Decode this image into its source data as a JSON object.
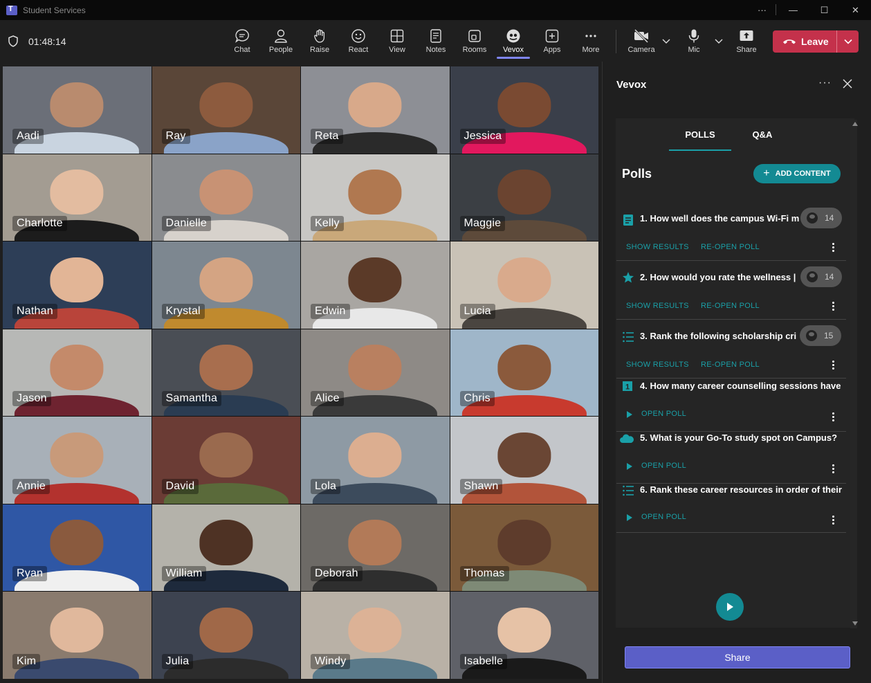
{
  "window": {
    "title": "Student Services",
    "controls": [
      "···",
      "—",
      "☐",
      "✕"
    ]
  },
  "meeting": {
    "timer": "01:48:14",
    "tools": [
      {
        "label": "Chat",
        "icon": "chat-icon"
      },
      {
        "label": "People",
        "icon": "people-icon"
      },
      {
        "label": "Raise",
        "icon": "raise-hand-icon"
      },
      {
        "label": "React",
        "icon": "react-smiley-icon"
      },
      {
        "label": "View",
        "icon": "view-grid-icon"
      },
      {
        "label": "Notes",
        "icon": "notes-icon"
      },
      {
        "label": "Rooms",
        "icon": "rooms-icon"
      },
      {
        "label": "Vevox",
        "icon": "vevox-icon",
        "active": true
      },
      {
        "label": "Apps",
        "icon": "apps-plus-icon"
      },
      {
        "label": "More",
        "icon": "more-dots-icon"
      }
    ],
    "camera_label": "Camera",
    "mic_label": "Mic",
    "share_label": "Share",
    "leave_label": "Leave",
    "leave_color": "#c4314b",
    "accent_color": "#7f85f5"
  },
  "participants": [
    "Aadi",
    "Ray",
    "Reta",
    "Jessica",
    "Charlotte",
    "Danielle",
    "Kelly",
    "Maggie",
    "Nathan",
    "Krystal",
    "Edwin",
    "Lucia",
    "Jason",
    "Samantha",
    "Alice",
    "Chris",
    "Annie",
    "David",
    "Lola",
    "Shawn",
    "Ryan",
    "William",
    "Deborah",
    "Thomas",
    "Kim",
    "Julia",
    "Windy",
    "Isabelle"
  ],
  "panel": {
    "title": "Vevox",
    "more": "···",
    "tabs": [
      "POLLS",
      "Q&A"
    ],
    "active_tab": "POLLS",
    "heading": "Polls",
    "add_content_label": "ADD CONTENT",
    "brand_color": "#138a93",
    "polls": [
      {
        "question": "1. How well does the campus Wi-Fi m",
        "icon": "text-poll-icon",
        "responses": "14",
        "actions": [
          "SHOW RESULTS",
          "RE-OPEN POLL"
        ]
      },
      {
        "question": "2. How would you rate the wellness |",
        "icon": "star-rating-icon",
        "responses": "14",
        "actions": [
          "SHOW RESULTS",
          "RE-OPEN POLL"
        ]
      },
      {
        "question": "3. Rank the following scholarship cri",
        "icon": "ranking-list-icon",
        "responses": "15",
        "actions": [
          "SHOW RESULTS",
          "RE-OPEN POLL"
        ]
      },
      {
        "question": "4. How many career counselling sessions have",
        "icon": "numeric-poll-icon",
        "actions": [
          "OPEN POLL"
        ]
      },
      {
        "question": "5. What is your Go-To study spot on Campus?",
        "icon": "word-cloud-icon",
        "actions": [
          "OPEN POLL"
        ]
      },
      {
        "question": "6. Rank these career resources in order of their",
        "icon": "ranking-list-icon",
        "actions": [
          "OPEN POLL"
        ]
      }
    ],
    "share_label": "Share"
  }
}
